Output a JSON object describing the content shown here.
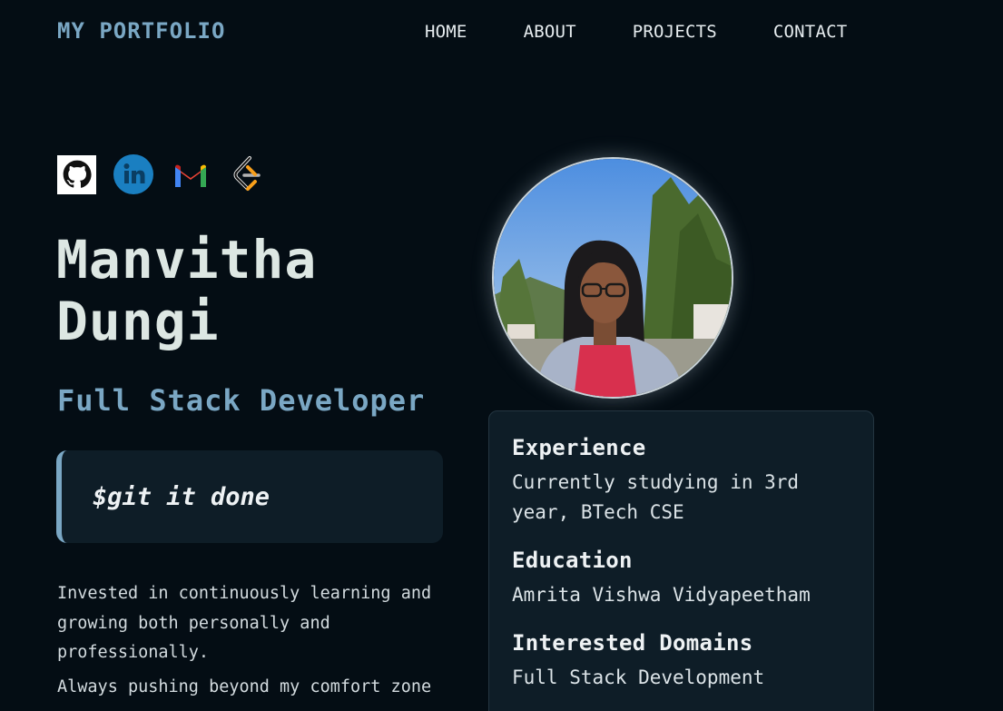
{
  "brand": "MY PORTFOLIO",
  "nav": {
    "items": [
      "HOME",
      "ABOUT",
      "PROJECTS",
      "CONTACT"
    ]
  },
  "socials": [
    {
      "name": "github-icon"
    },
    {
      "name": "linkedin-icon"
    },
    {
      "name": "gmail-icon"
    },
    {
      "name": "leetcode-icon"
    }
  ],
  "hero": {
    "name_line1": "Manvitha",
    "name_line2": "Dungi",
    "role": "Full Stack Developer",
    "quote": "$git it done",
    "bio": [
      "Invested in continuously learning and growing both personally and professionally.",
      "Always pushing beyond my comfort zone"
    ]
  },
  "profile": {
    "photo_alt": "profile-photo"
  },
  "card": {
    "experience_title": "Experience",
    "experience_value": "Currently studying in 3rd year, BTech CSE",
    "education_title": "Education",
    "education_value": "Amrita Vishwa Vidyapeetham",
    "domains_title": "Interested Domains",
    "domains_value": "Full Stack Development"
  },
  "colors": {
    "background": "#040d14",
    "accent": "#7aa7c4",
    "card": "#0e1d27"
  }
}
